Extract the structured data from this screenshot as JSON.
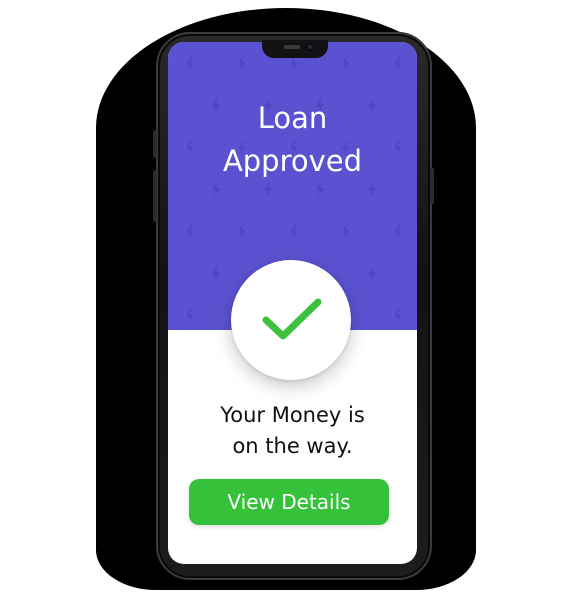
{
  "hero": {
    "title_line1": "Loan",
    "title_line2": "Approved",
    "background_color": "#5b52d1",
    "pattern_icon": "lightning-bolt-icon"
  },
  "status": {
    "icon": "checkmark-icon",
    "icon_color": "#3cc23f"
  },
  "message": {
    "line1": "Your Money is",
    "line2": "on the way."
  },
  "actions": {
    "view_details_label": "View Details",
    "button_color": "#35c23a"
  }
}
